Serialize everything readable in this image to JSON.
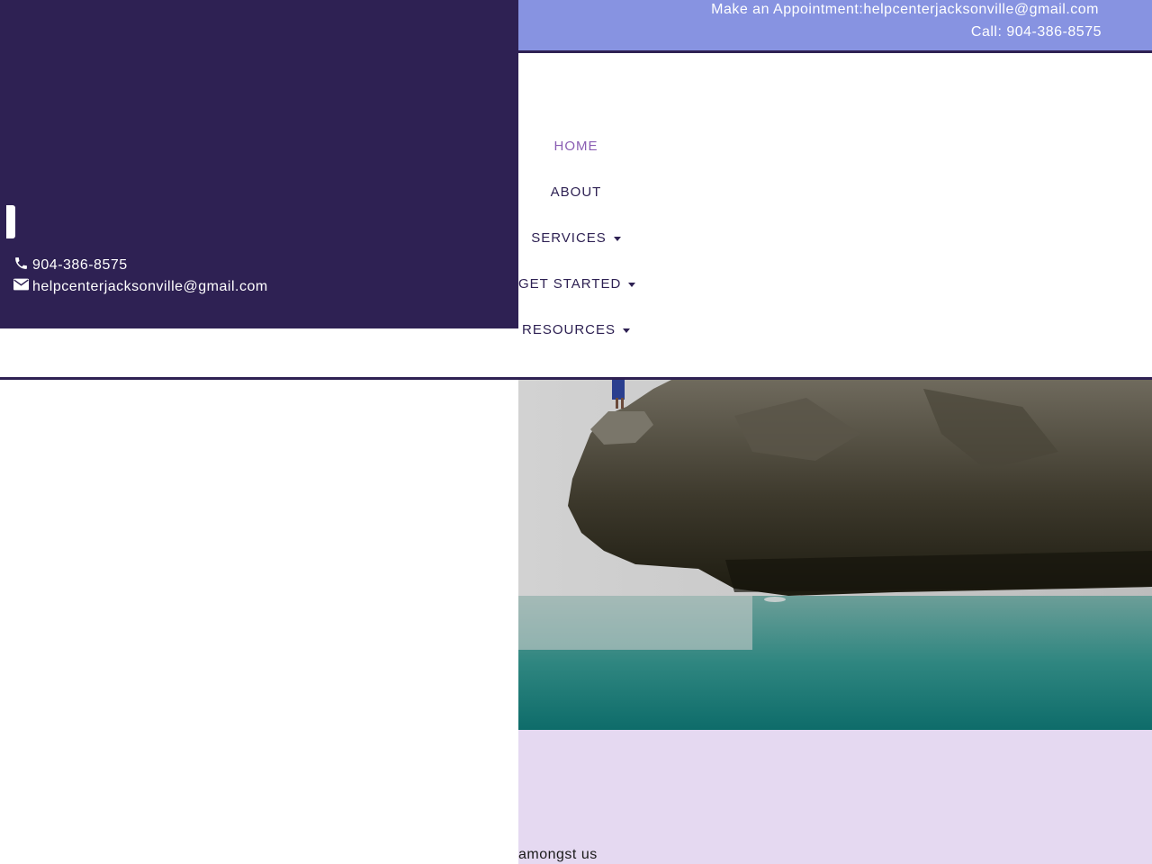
{
  "topbar": {
    "appointment": "Make an Appointment:helpcenterjacksonville@gmail.com",
    "call": "Call: 904-386-8575"
  },
  "nav": {
    "items": [
      {
        "label": "HOME",
        "active": true,
        "dropdown": false
      },
      {
        "label": "ABOUT",
        "active": false,
        "dropdown": false
      },
      {
        "label": "SERVICES",
        "active": false,
        "dropdown": true
      },
      {
        "label": "GET STARTED",
        "active": false,
        "dropdown": true
      },
      {
        "label": "RESOURCES",
        "active": false,
        "dropdown": true
      }
    ]
  },
  "panel": {
    "phone": "904-386-8575",
    "email": "helpcenterjacksonville@gmail.com",
    "phone_icon": "phone-icon",
    "email_icon": "envelope-icon"
  },
  "band": {
    "text": "amongst us"
  },
  "colors": {
    "topbar_bg": "#8793e1",
    "panel_bg": "#2e2153",
    "band_bg": "#e5d9f1",
    "nav_active": "#8a5db3",
    "nav_text": "#2e2153"
  }
}
